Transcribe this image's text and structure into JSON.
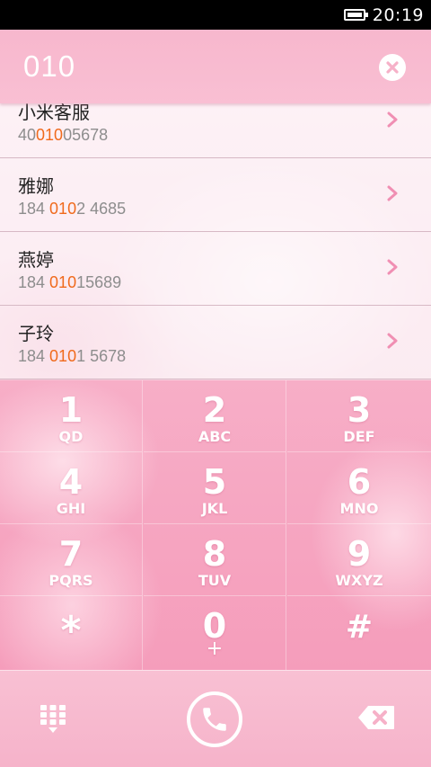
{
  "status_bar": {
    "time": "20:19"
  },
  "search": {
    "value": "010"
  },
  "contacts": [
    {
      "name": "小米客服",
      "number_prefix": "40",
      "number_match": "010",
      "number_suffix": "05678"
    },
    {
      "name": "雅娜",
      "number_prefix": "184 ",
      "number_match": "010",
      "number_suffix": "2 4685"
    },
    {
      "name": "燕婷",
      "number_prefix": "184 ",
      "number_match": "010",
      "number_suffix": "15689"
    },
    {
      "name": "子玲",
      "number_prefix": "184 ",
      "number_match": "010",
      "number_suffix": "1 5678"
    }
  ],
  "keypad": [
    {
      "digit": "1",
      "letters": "QD"
    },
    {
      "digit": "2",
      "letters": "ABC"
    },
    {
      "digit": "3",
      "letters": "DEF"
    },
    {
      "digit": "4",
      "letters": "GHI"
    },
    {
      "digit": "5",
      "letters": "JKL"
    },
    {
      "digit": "6",
      "letters": "MNO"
    },
    {
      "digit": "7",
      "letters": "PQRS"
    },
    {
      "digit": "8",
      "letters": "TUV"
    },
    {
      "digit": "9",
      "letters": "WXYZ"
    },
    {
      "digit": "*",
      "letters": ""
    },
    {
      "digit": "0",
      "letters": "+"
    },
    {
      "digit": "#",
      "letters": ""
    }
  ],
  "icons": {
    "battery": "battery-icon",
    "clear": "clear-icon",
    "chevron": "chevron-right-icon",
    "dialpad": "dialpad-icon",
    "call": "phone-icon",
    "backspace": "backspace-icon"
  },
  "colors": {
    "accent_pink": "#f7b7cd",
    "match_highlight": "#f06a1c",
    "chevron": "#f08fb3"
  }
}
